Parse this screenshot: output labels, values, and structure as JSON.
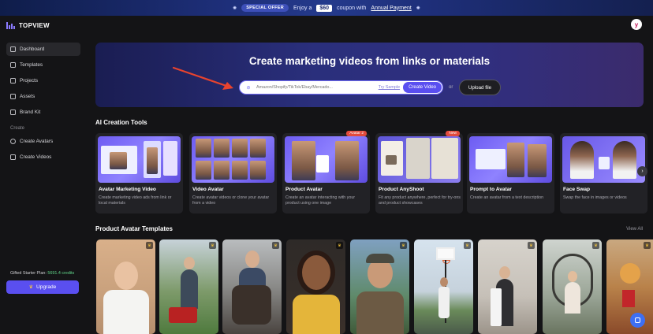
{
  "banner": {
    "offer_label": "SPECIAL OFFER",
    "text_before": "Enjoy a",
    "coupon": "$60",
    "text_after": "coupon with",
    "link": "Annual Payment"
  },
  "app": {
    "brand": "TOPVIEW",
    "user_initial": "y"
  },
  "sidebar": {
    "items": [
      {
        "label": "Dashboard",
        "icon": "dashboard-icon"
      },
      {
        "label": "Templates",
        "icon": "templates-icon"
      },
      {
        "label": "Projects",
        "icon": "projects-icon"
      },
      {
        "label": "Assets",
        "icon": "assets-icon"
      },
      {
        "label": "Brand Kit",
        "icon": "brand-kit-icon"
      }
    ],
    "section_label": "Create",
    "create_items": [
      {
        "label": "Create Avatars",
        "icon": "avatar-icon"
      },
      {
        "label": "Create Videos",
        "icon": "video-icon"
      }
    ],
    "plan_label": "Gifted Starter Plan:",
    "plan_credits": "5691.4 credits",
    "upgrade_label": "Upgrade"
  },
  "hero": {
    "title": "Create marketing videos from links or materials",
    "input_placeholder": "Amazon/Shopify/TikTok/Ebay/Mercado...",
    "try_sample": "Try Sample",
    "create_button": "Create Video",
    "or_label": "or",
    "upload_button": "Upload file"
  },
  "tools": {
    "title": "AI Creation Tools",
    "cards": [
      {
        "name": "Avatar Marketing Video",
        "desc": "Create marketing video ads from link or local materials",
        "badge": ""
      },
      {
        "name": "Video Avatar",
        "desc": "Create avatar videos or clone your avatar from a video",
        "badge": ""
      },
      {
        "name": "Product Avatar",
        "desc": "Create an avatar interacting with your product using one image",
        "badge": "Avatar 2"
      },
      {
        "name": "Product AnyShoot",
        "desc": "Fit any product anywhere, perfect for try-ons and product showcases",
        "badge": "New"
      },
      {
        "name": "Prompt to Avatar",
        "desc": "Create an avatar from a text description",
        "badge": ""
      },
      {
        "name": "Face Swap",
        "desc": "Swap the face in images or videos",
        "badge": ""
      }
    ]
  },
  "templates": {
    "title": "Product Avatar Templates",
    "view_all": "View All"
  },
  "colors": {
    "accent": "#5a4ff0",
    "background": "#141416",
    "card": "#222226"
  }
}
